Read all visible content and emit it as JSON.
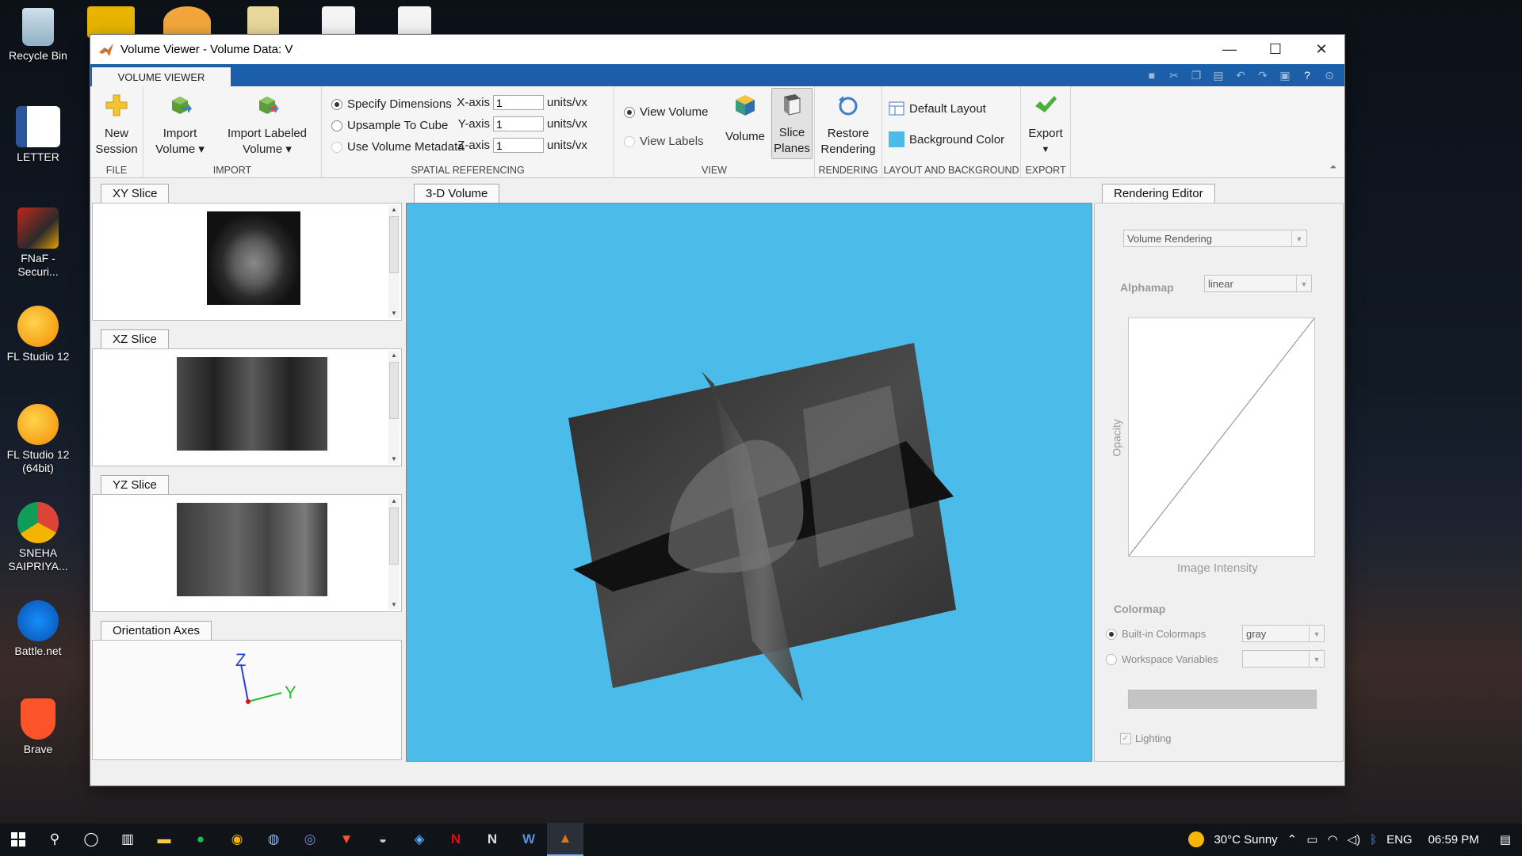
{
  "desktop": {
    "icons": [
      {
        "label": "Recycle Bin"
      },
      {
        "label": "LETTER"
      },
      {
        "label": "FNaF - Securi..."
      },
      {
        "label": "FL Studio 12"
      },
      {
        "label": "FL Studio 12 (64bit)"
      },
      {
        "label": "SNEHA SAIPRIYA..."
      },
      {
        "label": "Battle.net"
      },
      {
        "label": "Brave"
      }
    ]
  },
  "window": {
    "title": "Volume Viewer - Volume Data: V",
    "controls": {
      "minimize": "—",
      "maximize": "☐",
      "close": "✕"
    }
  },
  "ribbon": {
    "tab": "VOLUME VIEWER",
    "file": {
      "label": "FILE",
      "new_session_l1": "New",
      "new_session_l2": "Session"
    },
    "import": {
      "label": "IMPORT",
      "import_volume_l1": "Import",
      "import_volume_l2": "Volume ▾",
      "import_labeled_l1": "Import Labeled",
      "import_labeled_l2": "Volume ▾"
    },
    "spatial": {
      "label": "SPATIAL REFERENCING",
      "options": [
        "Specify Dimensions",
        "Upsample To Cube",
        "Use Volume Metadata"
      ],
      "selected": "Specify Dimensions",
      "axes": [
        {
          "label": "X-axis",
          "value": "1",
          "unit": "units/vx"
        },
        {
          "label": "Y-axis",
          "value": "1",
          "unit": "units/vx"
        },
        {
          "label": "Z-axis",
          "value": "1",
          "unit": "units/vx"
        }
      ]
    },
    "view": {
      "label": "VIEW",
      "view_volume": "View Volume",
      "view_labels": "View Labels",
      "volume": "Volume",
      "slice_planes_l1": "Slice",
      "slice_planes_l2": "Planes"
    },
    "rendering": {
      "label": "RENDERING",
      "restore_l1": "Restore",
      "restore_l2": "Rendering"
    },
    "layout": {
      "label": "LAYOUT AND BACKGROUND",
      "default_layout": "Default Layout",
      "background_color": "Background Color",
      "bg_swatch": "#4bbbe9"
    },
    "export": {
      "label": "EXPORT",
      "button": "Export"
    }
  },
  "panels": {
    "xy": "XY Slice",
    "xz": "XZ Slice",
    "yz": "YZ Slice",
    "orientation": "Orientation Axes",
    "axis_z": "Z",
    "axis_y": "Y",
    "volume": "3-D Volume",
    "rendering_editor": "Rendering Editor"
  },
  "editor": {
    "mode": "Volume Rendering",
    "alphamap_label": "Alphamap",
    "alphamap_value": "linear",
    "opacity_label": "Opacity",
    "intensity_label": "Image Intensity",
    "colormap_label": "Colormap",
    "builtin_label": "Built-in Colormaps",
    "builtin_value": "gray",
    "workspace_label": "Workspace Variables",
    "workspace_value": "",
    "lighting_label": "Lighting"
  },
  "taskbar": {
    "weather": "30°C  Sunny",
    "lang": "ENG",
    "time": "06:59 PM"
  }
}
